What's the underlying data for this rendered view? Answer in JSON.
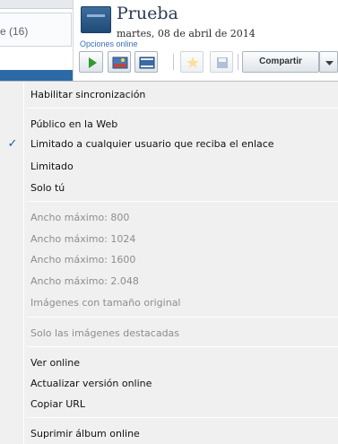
{
  "left_pane": {
    "folder_count": "e (16)"
  },
  "album": {
    "title": "Prueba",
    "date": "martes, 08 de abril de 2014",
    "online_options": "Opciones online"
  },
  "toolbar": {
    "share_label": "Compartir",
    "icons": [
      "play-icon",
      "photo-upload-icon",
      "film-icon",
      "star-icon",
      "save-icon",
      "chevron-down-icon"
    ]
  },
  "menu": {
    "enable_sync": "Habilitar sincronización",
    "public_web": "Público en la Web",
    "limited_link": "Limitado a cualquier usuario que reciba el enlace",
    "limited": "Limitado",
    "only_you": "Solo tú",
    "width_800": "Ancho máximo: 800",
    "width_1024": "Ancho máximo: 1024",
    "width_1600": "Ancho máximo: 1600",
    "width_2048": "Ancho máximo: 2.048",
    "original_size": "Imágenes con tamaño original",
    "featured_only": "Solo las imágenes destacadas",
    "view_online": "Ver online",
    "update_online": "Actualizar versión online",
    "copy_url": "Copiar URL",
    "delete_online": "Suprimir álbum online",
    "checked_item": "limited_link",
    "check_mark": "✓"
  },
  "colors": {
    "accent": "#2c6aa6",
    "check": "#1a5fb4",
    "disabled_text": "#8d8d8d"
  }
}
